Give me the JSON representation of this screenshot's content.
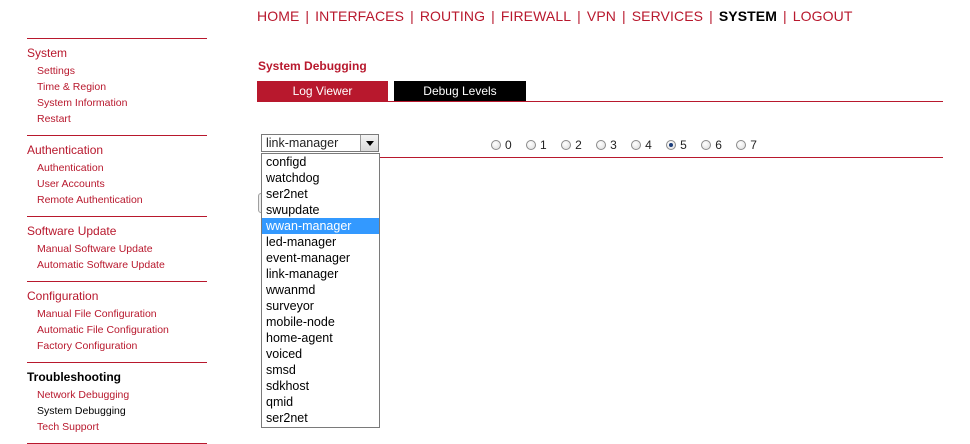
{
  "nav": {
    "items": [
      {
        "label": "HOME"
      },
      {
        "label": "INTERFACES"
      },
      {
        "label": "ROUTING"
      },
      {
        "label": "FIREWALL"
      },
      {
        "label": "VPN"
      },
      {
        "label": "SERVICES"
      },
      {
        "label": "SYSTEM"
      },
      {
        "label": "LOGOUT"
      }
    ],
    "active": "SYSTEM"
  },
  "sidebar": {
    "sections": [
      {
        "title": "System",
        "items": [
          "Settings",
          "Time & Region",
          "System Information",
          "Restart"
        ]
      },
      {
        "title": "Authentication",
        "items": [
          "Authentication",
          "User Accounts",
          "Remote Authentication"
        ]
      },
      {
        "title": "Software Update",
        "items": [
          "Manual Software Update",
          "Automatic Software Update"
        ]
      },
      {
        "title": "Configuration",
        "items": [
          "Manual File Configuration",
          "Automatic File Configuration",
          "Factory Configuration"
        ]
      },
      {
        "title": "Troubleshooting",
        "items": [
          "Network Debugging",
          "System Debugging",
          "Tech Support"
        ]
      }
    ],
    "current_item": "System Debugging"
  },
  "main": {
    "title": "System Debugging",
    "tabs": {
      "log_viewer": "Log Viewer",
      "debug_levels": "Debug Levels"
    },
    "select": {
      "value": "link-manager",
      "highlighted": "wwan-manager",
      "options": [
        "configd",
        "watchdog",
        "ser2net",
        "swupdate",
        "wwan-manager",
        "led-manager",
        "event-manager",
        "link-manager",
        "wwanmd",
        "surveyor",
        "mobile-node",
        "home-agent",
        "voiced",
        "smsd",
        "sdkhost",
        "qmid",
        "ser2net"
      ]
    },
    "levels": {
      "options": [
        "0",
        "1",
        "2",
        "3",
        "4",
        "5",
        "6",
        "7"
      ],
      "selected": "5"
    }
  },
  "colors": {
    "accent": "#b8182d",
    "tab_dark": "#000000",
    "highlight": "#3399ff"
  }
}
